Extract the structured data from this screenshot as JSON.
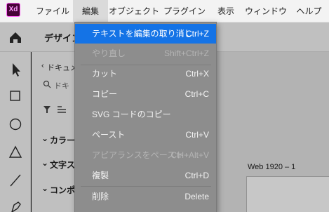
{
  "app": {
    "icon_label": "Xd"
  },
  "menubar": {
    "items": [
      "ファイル",
      "編集",
      "オブジェクト",
      "プラグイン",
      "表示",
      "ウィンドウ",
      "ヘルプ"
    ],
    "active_index": 1
  },
  "toolbar": {
    "tab_label": "デザイン"
  },
  "panel": {
    "back_label": "ドキュメ",
    "search_placeholder": "ドキ",
    "sections": [
      "カラー",
      "文字ス",
      "コンポー"
    ]
  },
  "canvas": {
    "artboard_name": "Web 1920 – 1"
  },
  "edit_menu": {
    "items": [
      {
        "label": "テキストを編集の取り消し",
        "shortcut": "Ctrl+Z",
        "state": "highlighted"
      },
      {
        "label": "やり直し",
        "shortcut": "Shift+Ctrl+Z",
        "state": "disabled"
      },
      {
        "label": "カット",
        "shortcut": "Ctrl+X",
        "state": "enabled"
      },
      {
        "label": "コピー",
        "shortcut": "Ctrl+C",
        "state": "enabled"
      },
      {
        "label": "SVG コードのコピー",
        "shortcut": "",
        "state": "enabled"
      },
      {
        "label": "ペースト",
        "shortcut": "Ctrl+V",
        "state": "enabled"
      },
      {
        "label": "アピアランスをペースト",
        "shortcut": "Ctrl+Alt+V",
        "state": "disabled"
      },
      {
        "label": "複製",
        "shortcut": "Ctrl+D",
        "state": "enabled"
      },
      {
        "label": "削除",
        "shortcut": "Delete",
        "state": "enabled"
      }
    ]
  },
  "colors": {
    "highlight": "#1473e6",
    "brand": "#470137",
    "brand_accent": "#ff61f6"
  }
}
